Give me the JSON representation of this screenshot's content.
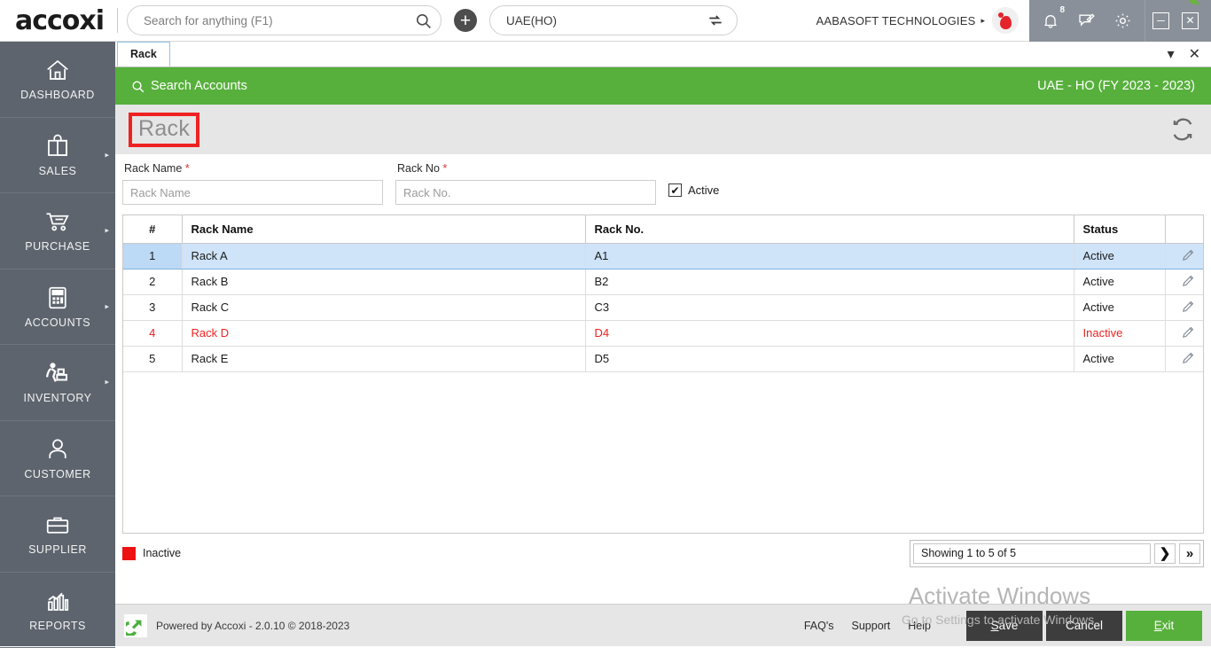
{
  "app": {
    "brand": "accoxi",
    "brand_leaf_color": "#6cb33f",
    "accent_green": "#57b03c",
    "sidebar_bg": "#5d646d"
  },
  "topbar": {
    "search_placeholder": "Search for anything (F1)",
    "search_value": "",
    "add_label": "+",
    "branch_value": "UAE(HO)",
    "company_name": "AABASOFT TECHNOLOGIES",
    "company_caret": "▸",
    "notification_count": "8",
    "minimize_label": "─",
    "close_label": "✕"
  },
  "sidebar": {
    "items": [
      {
        "label": "DASHBOARD",
        "icon": "home-icon",
        "has_arrow": false
      },
      {
        "label": "SALES",
        "icon": "shopping-bag-icon",
        "has_arrow": true
      },
      {
        "label": "PURCHASE",
        "icon": "shopping-cart-icon",
        "has_arrow": true
      },
      {
        "label": "ACCOUNTS",
        "icon": "calculator-icon",
        "has_arrow": true
      },
      {
        "label": "INVENTORY",
        "icon": "warehouse-worker-icon",
        "has_arrow": true
      },
      {
        "label": "CUSTOMER",
        "icon": "person-icon",
        "has_arrow": false
      },
      {
        "label": "SUPPLIER",
        "icon": "briefcase-icon",
        "has_arrow": false
      },
      {
        "label": "REPORTS",
        "icon": "bar-chart-icon",
        "has_arrow": false
      }
    ]
  },
  "tabstrip": {
    "tabs": [
      {
        "label": "Rack",
        "active": true
      }
    ],
    "dropdown_label": "▾",
    "close_label": "✕"
  },
  "greenbar": {
    "search_accounts_label": "Search Accounts",
    "context_label": "UAE - HO (FY 2023 - 2023)"
  },
  "page": {
    "title": "Rack",
    "title_highlight_color": "#ee2222",
    "refresh_label": "refresh-icon"
  },
  "form": {
    "rack_name": {
      "label": "Rack Name",
      "required_marker": "*",
      "placeholder": "Rack Name",
      "value": ""
    },
    "rack_no": {
      "label": "Rack No",
      "required_marker": "*",
      "placeholder": "Rack No.",
      "value": ""
    },
    "active": {
      "label": "Active",
      "checked": true,
      "check_glyph": "✔"
    }
  },
  "table": {
    "headers": [
      "#",
      "Rack Name",
      "Rack No.",
      "Status",
      ""
    ],
    "rows": [
      {
        "idx": "1",
        "name": "Rack A",
        "no": "A1",
        "status": "Active",
        "selected": true,
        "inactive": false
      },
      {
        "idx": "2",
        "name": "Rack B",
        "no": "B2",
        "status": "Active",
        "selected": false,
        "inactive": false
      },
      {
        "idx": "3",
        "name": "Rack C",
        "no": "C3",
        "status": "Active",
        "selected": false,
        "inactive": false
      },
      {
        "idx": "4",
        "name": "Rack D",
        "no": "D4",
        "status": "Inactive",
        "selected": false,
        "inactive": true
      },
      {
        "idx": "5",
        "name": "Rack E",
        "no": "D5",
        "status": "Active",
        "selected": false,
        "inactive": false
      }
    ]
  },
  "legend": {
    "inactive_label": "Inactive",
    "inactive_color": "#ee1111"
  },
  "pagination": {
    "showing_text": "Showing 1 to 5 of 5",
    "next_label": "❯",
    "last_label": "»"
  },
  "footer": {
    "powered_text": "Powered by Accoxi - 2.0.10 © 2018-2023",
    "links": [
      "FAQ's",
      "Support",
      "Help"
    ],
    "buttons": [
      {
        "label": "Save",
        "accesskey": "S",
        "style": "dark"
      },
      {
        "label": "Cancel",
        "accesskey": "",
        "style": "dark"
      },
      {
        "label": "Exit",
        "accesskey": "E",
        "style": "green"
      }
    ]
  },
  "watermark": {
    "line1": "Activate Windows",
    "line2": "Go to Settings to activate Windows."
  }
}
